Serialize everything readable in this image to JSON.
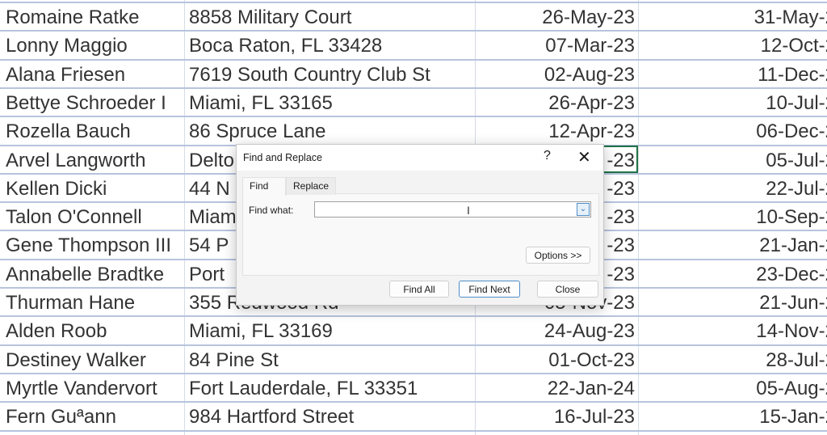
{
  "rows": [
    [
      "Romaine Ratke",
      "8858 Military Court",
      "26-May-23",
      "31-May-2"
    ],
    [
      "Lonny Maggio",
      "Boca Raton, FL 33428",
      "07-Mar-23",
      "12-Oct-2"
    ],
    [
      "Alana Friesen",
      "7619 South Country Club St",
      "02-Aug-23",
      "11-Dec-2"
    ],
    [
      "Bettye Schroeder I",
      "Miami, FL 33165",
      "26-Apr-23",
      "10-Jul-2"
    ],
    [
      "Rozella Bauch",
      "86 Spruce Lane",
      "12-Apr-23",
      "06-Dec-2"
    ],
    [
      "Arvel Langworth",
      "Delto",
      "-23",
      "05-Jul-2"
    ],
    [
      "Kellen Dicki",
      "44 N",
      "-23",
      "22-Jul-2"
    ],
    [
      "Talon O'Connell",
      "Miam",
      "-23",
      "10-Sep-2"
    ],
    [
      "Gene Thompson III",
      "54 P",
      "-23",
      "21-Jan-2"
    ],
    [
      "Annabelle Bradtke",
      "Port",
      "-23",
      "23-Dec-2"
    ],
    [
      "Thurman Hane",
      "355 Redwood Rd",
      "05-Nov-23",
      "21-Jun-2"
    ],
    [
      "Alden Roob",
      "Miami, FL 33169",
      "24-Aug-23",
      "14-Nov-2"
    ],
    [
      "Destiney Walker",
      "84 Pine St",
      "01-Oct-23",
      "28-Jul-2"
    ],
    [
      "Myrtle Vandervort",
      "Fort Lauderdale, FL 33351",
      "22-Jan-24",
      "05-Aug-2"
    ],
    [
      "Fern Guªann",
      "984 Hartford Street",
      "16-Jul-23",
      "15-Jan-2"
    ]
  ],
  "dialog": {
    "title": "Find and Replace",
    "help": "?",
    "close_glyph": "✕",
    "tabs": [
      "Find",
      "Replace"
    ],
    "find_label": "Find what:",
    "find_value": "",
    "buttons": {
      "options": "Options >>",
      "find_all": "Find All",
      "find_next": "Find Next",
      "close": "Close"
    }
  },
  "colors": {
    "selection": "#217346",
    "gridline": "#b6c4de",
    "accent": "#4f8ec9"
  }
}
